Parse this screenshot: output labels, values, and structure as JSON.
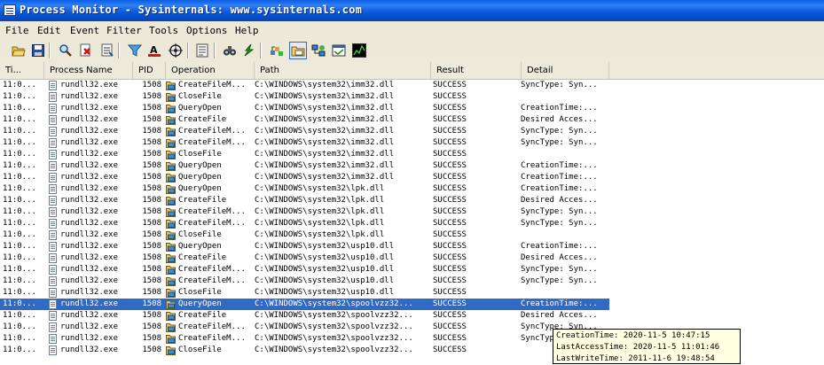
{
  "window": {
    "title": "Process Monitor - Sysinternals: www.sysinternals.com"
  },
  "menu": [
    {
      "key": "F",
      "rest": "ile"
    },
    {
      "key": "E",
      "rest": "dit"
    },
    {
      "key": "E",
      "rest": "vent"
    },
    {
      "key": "F",
      "rest": "ilter",
      "prefix": ""
    },
    {
      "key": "T",
      "rest": "ools"
    },
    {
      "key": "O",
      "rest": "ptions"
    },
    {
      "key": "H",
      "rest": "elp"
    }
  ],
  "menu_labels": [
    "File",
    "Edit",
    "Event",
    "Filter",
    "Tools",
    "Options",
    "Help"
  ],
  "toolbar": {
    "icons": [
      "open-icon",
      "save-icon",
      "magnifier-icon",
      "capture-icon",
      "autoscroll-icon",
      "filter-icon",
      "highlight-icon",
      "target-icon",
      "properties-icon",
      "find-icon",
      "jump-icon",
      "registry-icon",
      "filesystem-icon",
      "network-icon",
      "process-icon",
      "profiling-icon"
    ]
  },
  "columns": {
    "time": "Ti...",
    "process": "Process Name",
    "pid": "PID",
    "operation": "Operation",
    "path": "Path",
    "result": "Result",
    "detail": "Detail"
  },
  "rows": [
    {
      "time": "11:0...",
      "process": "rundll32.exe",
      "pid": "1508",
      "op": "CreateFileM...",
      "path": "C:\\WINDOWS\\system32\\imm32.dll",
      "result": "SUCCESS",
      "detail": "SyncType: Syn..."
    },
    {
      "time": "11:0...",
      "process": "rundll32.exe",
      "pid": "1508",
      "op": "CloseFile",
      "path": "C:\\WINDOWS\\system32\\imm32.dll",
      "result": "SUCCESS",
      "detail": ""
    },
    {
      "time": "11:0...",
      "process": "rundll32.exe",
      "pid": "1508",
      "op": "QueryOpen",
      "path": "C:\\WINDOWS\\system32\\imm32.dll",
      "result": "SUCCESS",
      "detail": "CreationTime:..."
    },
    {
      "time": "11:0...",
      "process": "rundll32.exe",
      "pid": "1508",
      "op": "CreateFile",
      "path": "C:\\WINDOWS\\system32\\imm32.dll",
      "result": "SUCCESS",
      "detail": "Desired Acces..."
    },
    {
      "time": "11:0...",
      "process": "rundll32.exe",
      "pid": "1508",
      "op": "CreateFileM...",
      "path": "C:\\WINDOWS\\system32\\imm32.dll",
      "result": "SUCCESS",
      "detail": "SyncType: Syn..."
    },
    {
      "time": "11:0...",
      "process": "rundll32.exe",
      "pid": "1508",
      "op": "CreateFileM...",
      "path": "C:\\WINDOWS\\system32\\imm32.dll",
      "result": "SUCCESS",
      "detail": "SyncType: Syn..."
    },
    {
      "time": "11:0...",
      "process": "rundll32.exe",
      "pid": "1508",
      "op": "CloseFile",
      "path": "C:\\WINDOWS\\system32\\imm32.dll",
      "result": "SUCCESS",
      "detail": ""
    },
    {
      "time": "11:0...",
      "process": "rundll32.exe",
      "pid": "1508",
      "op": "QueryOpen",
      "path": "C:\\WINDOWS\\system32\\imm32.dll",
      "result": "SUCCESS",
      "detail": "CreationTime:..."
    },
    {
      "time": "11:0...",
      "process": "rundll32.exe",
      "pid": "1508",
      "op": "QueryOpen",
      "path": "C:\\WINDOWS\\system32\\imm32.dll",
      "result": "SUCCESS",
      "detail": "CreationTime:..."
    },
    {
      "time": "11:0...",
      "process": "rundll32.exe",
      "pid": "1508",
      "op": "QueryOpen",
      "path": "C:\\WINDOWS\\system32\\lpk.dll",
      "result": "SUCCESS",
      "detail": "CreationTime:..."
    },
    {
      "time": "11:0...",
      "process": "rundll32.exe",
      "pid": "1508",
      "op": "CreateFile",
      "path": "C:\\WINDOWS\\system32\\lpk.dll",
      "result": "SUCCESS",
      "detail": "Desired Acces..."
    },
    {
      "time": "11:0...",
      "process": "rundll32.exe",
      "pid": "1508",
      "op": "CreateFileM...",
      "path": "C:\\WINDOWS\\system32\\lpk.dll",
      "result": "SUCCESS",
      "detail": "SyncType: Syn..."
    },
    {
      "time": "11:0...",
      "process": "rundll32.exe",
      "pid": "1508",
      "op": "CreateFileM...",
      "path": "C:\\WINDOWS\\system32\\lpk.dll",
      "result": "SUCCESS",
      "detail": "SyncType: Syn..."
    },
    {
      "time": "11:0...",
      "process": "rundll32.exe",
      "pid": "1508",
      "op": "CloseFile",
      "path": "C:\\WINDOWS\\system32\\lpk.dll",
      "result": "SUCCESS",
      "detail": ""
    },
    {
      "time": "11:0...",
      "process": "rundll32.exe",
      "pid": "1508",
      "op": "QueryOpen",
      "path": "C:\\WINDOWS\\system32\\usp10.dll",
      "result": "SUCCESS",
      "detail": "CreationTime:..."
    },
    {
      "time": "11:0...",
      "process": "rundll32.exe",
      "pid": "1508",
      "op": "CreateFile",
      "path": "C:\\WINDOWS\\system32\\usp10.dll",
      "result": "SUCCESS",
      "detail": "Desired Acces..."
    },
    {
      "time": "11:0...",
      "process": "rundll32.exe",
      "pid": "1508",
      "op": "CreateFileM...",
      "path": "C:\\WINDOWS\\system32\\usp10.dll",
      "result": "SUCCESS",
      "detail": "SyncType: Syn..."
    },
    {
      "time": "11:0...",
      "process": "rundll32.exe",
      "pid": "1508",
      "op": "CreateFileM...",
      "path": "C:\\WINDOWS\\system32\\usp10.dll",
      "result": "SUCCESS",
      "detail": "SyncType: Syn..."
    },
    {
      "time": "11:0...",
      "process": "rundll32.exe",
      "pid": "1508",
      "op": "CloseFile",
      "path": "C:\\WINDOWS\\system32\\usp10.dll",
      "result": "SUCCESS",
      "detail": ""
    },
    {
      "time": "11:0...",
      "process": "rundll32.exe",
      "pid": "1508",
      "op": "QueryOpen",
      "path": "C:\\WINDOWS\\system32\\spoolvzz32...",
      "result": "SUCCESS",
      "detail": "CreationTime:...",
      "selected": true
    },
    {
      "time": "11:0...",
      "process": "rundll32.exe",
      "pid": "1508",
      "op": "CreateFile",
      "path": "C:\\WINDOWS\\system32\\spoolvzz32...",
      "result": "SUCCESS",
      "detail": "Desired Acces..."
    },
    {
      "time": "11:0...",
      "process": "rundll32.exe",
      "pid": "1508",
      "op": "CreateFileM...",
      "path": "C:\\WINDOWS\\system32\\spoolvzz32...",
      "result": "SUCCESS",
      "detail": "SyncType: Syn..."
    },
    {
      "time": "11:0...",
      "process": "rundll32.exe",
      "pid": "1508",
      "op": "CreateFileM...",
      "path": "C:\\WINDOWS\\system32\\spoolvzz32...",
      "result": "SUCCESS",
      "detail": "SyncType: Syn..."
    },
    {
      "time": "11:0...",
      "process": "rundll32.exe",
      "pid": "1508",
      "op": "CloseFile",
      "path": "C:\\WINDOWS\\system32\\spoolvzz32...",
      "result": "SUCCESS",
      "detail": ""
    }
  ],
  "tooltip": {
    "line1": "CreationTime: 2020-11-5 10:47:15",
    "line2": "LastAccessTime: 2020-11-5 11:01:46",
    "line3": "LastWriteTime: 2011-11-6 19:48:54"
  },
  "colors": {
    "titlebar": "#0a5de6",
    "selection": "#316ac5",
    "chrome": "#ece9d8",
    "tooltip": "#ffffe1"
  }
}
